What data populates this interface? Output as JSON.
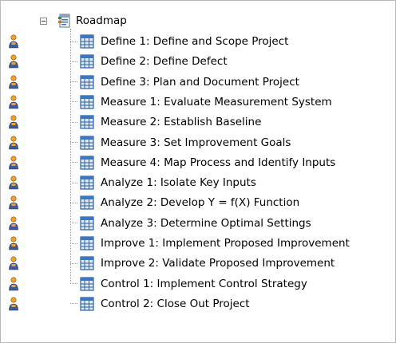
{
  "root": {
    "label": "Roadmap"
  },
  "items": [
    {
      "label": "Define 1: Define and Scope Project"
    },
    {
      "label": "Define 2: Define Defect"
    },
    {
      "label": "Define 3: Plan and Document Project"
    },
    {
      "label": "Measure 1: Evaluate Measurement System"
    },
    {
      "label": "Measure 2: Establish Baseline"
    },
    {
      "label": "Measure 3: Set Improvement Goals"
    },
    {
      "label": "Measure 4: Map Process and Identify Inputs"
    },
    {
      "label": "Analyze 1: Isolate Key Inputs"
    },
    {
      "label": "Analyze 2: Develop Y = f(X) Function"
    },
    {
      "label": "Analyze 3: Determine Optimal Settings"
    },
    {
      "label": "Improve 1: Implement Proposed Improvement"
    },
    {
      "label": "Improve 2: Validate Proposed Improvement"
    },
    {
      "label": "Control 1: Implement Control Strategy"
    },
    {
      "label": "Control 2: Close Out Project"
    }
  ],
  "icons": {
    "expander": "minus-expander-icon",
    "root": "roadmap-document-icon",
    "item": "table-grid-icon",
    "gutter": "person-icon"
  },
  "colors": {
    "person_head": "#f0a030",
    "person_body": "#3c5a9a",
    "grid_border": "#2a5f9e",
    "grid_header": "#3b78c4",
    "grid_fill": "#dfeaf6",
    "tree_lines": "#999999"
  }
}
